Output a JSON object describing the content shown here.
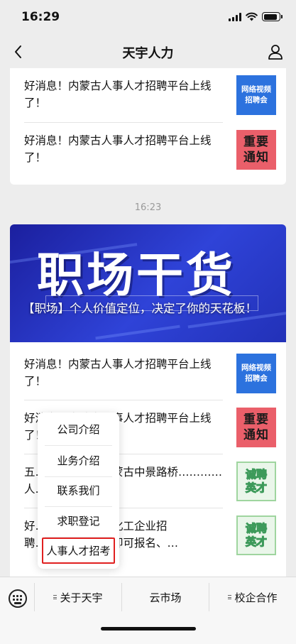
{
  "status": {
    "time": "16:29",
    "battery_level": 0.9
  },
  "nav": {
    "title": "天宇人力",
    "back_icon": "chevron-left-icon",
    "profile_icon": "person-icon"
  },
  "articles_top": [
    {
      "title": "好消息！内蒙古人事人才招聘平台上线了！",
      "thumb": {
        "style": "blue",
        "lines": [
          "网络视频",
          "招聘会"
        ]
      }
    },
    {
      "title": "好消息！内蒙古人事人才招聘平台上线了！",
      "thumb": {
        "style": "red",
        "lines": [
          "重要",
          "通知"
        ]
      }
    }
  ],
  "time_separator": "16:23",
  "banner": {
    "big_text": "职场干货",
    "caption": "【职场】个人价值定位，决定了你的天花板！"
  },
  "articles_bottom": [
    {
      "title": "好消息！内蒙古人事人才招聘平台上线了！",
      "thumb": {
        "style": "blue",
        "lines": [
          "网络视频",
          "招聘会"
        ]
      }
    },
    {
      "title": "好消息！内蒙古人事人才招聘平台上线了！",
      "thumb": {
        "style": "red",
        "lines": [
          "重要",
          "通知"
        ]
      }
    },
    {
      "title": "五…………宿！内蒙古中景路桥…………人…",
      "thumb": {
        "style": "green",
        "lines": [
          "诚聘",
          "英才"
        ]
      }
    },
    {
      "title": "好…………家能源化工企业招聘…………、专科即可报名、…",
      "thumb": {
        "style": "green",
        "lines": [
          "诚聘",
          "英才"
        ]
      }
    }
  ],
  "popup_menu": {
    "items": [
      "公司介绍",
      "业务介绍",
      "联系我们",
      "求职登记",
      "人事人才招考"
    ],
    "highlighted_index": 4
  },
  "bottom_menu": {
    "keyboard_icon": "keyboard-icon",
    "tabs": [
      "关于天宇",
      "云市场",
      "校企合作"
    ]
  },
  "colors": {
    "highlight": "#e02020",
    "banner": "#2f43d8",
    "thumb_blue": "#2c72de",
    "thumb_red": "#ea5f6a"
  }
}
